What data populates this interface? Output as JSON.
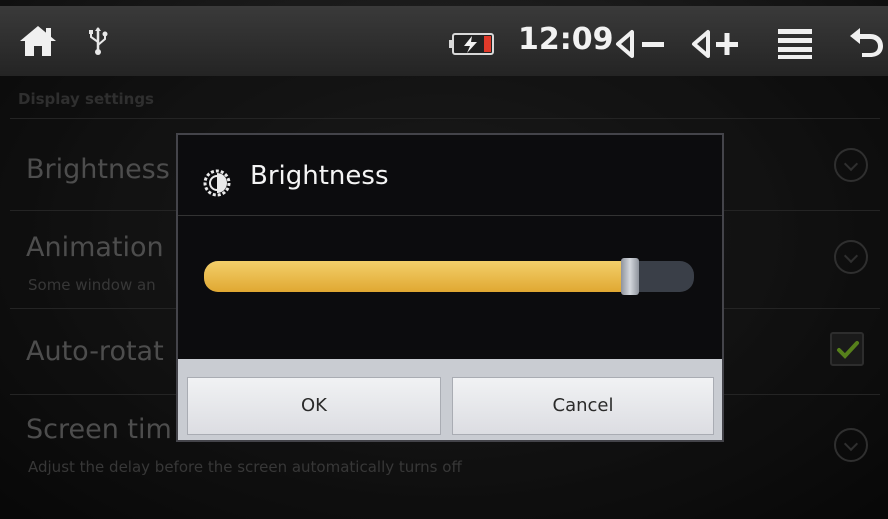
{
  "status_bar": {
    "time": "12:09",
    "icons": [
      "home-icon",
      "usb-icon",
      "battery-charging-icon",
      "volume-down-icon",
      "volume-up-icon",
      "menu-icon",
      "back-icon"
    ]
  },
  "settings": {
    "section_header": "Display settings",
    "items": [
      {
        "title": "Brightness",
        "summary": ""
      },
      {
        "title": "Animation",
        "summary": "Some window an"
      },
      {
        "title": "Auto-rotat",
        "summary": ""
      },
      {
        "title": "Screen tim",
        "summary": "Adjust the delay before the screen automatically turns off"
      }
    ],
    "auto_rotate_checked": true
  },
  "dialog": {
    "title": "Brightness",
    "icon": "brightness-icon",
    "slider_value": 0.87,
    "ok_label": "OK",
    "cancel_label": "Cancel"
  },
  "colors": {
    "slider_fill": "#e8b94a",
    "check_mark": "#8ccf2c"
  }
}
